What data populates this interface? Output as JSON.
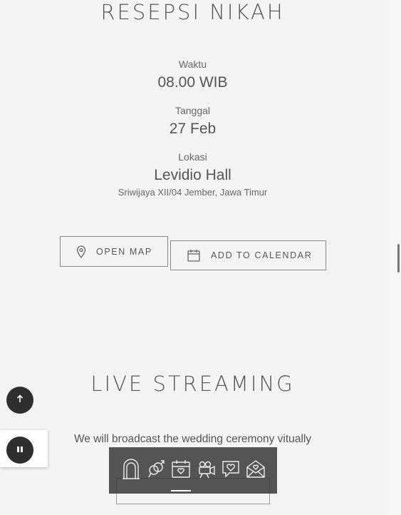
{
  "reception": {
    "title": "RESEPSI NIKAH",
    "time_label": "Waktu",
    "time_value": "08.00 WIB",
    "date_label": "Tanggal",
    "date_value": "27 Feb",
    "location_label": "Lokasi",
    "location_value": "Levidio Hall",
    "address": "Sriwijaya XII/04 Jember, Jawa Timur",
    "open_map_label": "OPEN MAP",
    "add_calendar_label": "ADD TO CALENDAR"
  },
  "live": {
    "title": "LIVE STREAMING",
    "subtitle": "We will broadcast the wedding ceremony vitually"
  },
  "bottom_nav": {
    "items": [
      {
        "icon": "wedding-arch-icon",
        "active": false
      },
      {
        "icon": "couple-rings-icon",
        "active": false
      },
      {
        "icon": "calendar-heart-icon",
        "active": true
      },
      {
        "icon": "video-camera-icon",
        "active": false
      },
      {
        "icon": "photo-heart-icon",
        "active": false
      },
      {
        "icon": "envelope-heart-icon",
        "active": false
      }
    ]
  },
  "floating": {
    "scroll_top_icon": "arrow-up-icon",
    "music_icon": "pause-icon"
  }
}
